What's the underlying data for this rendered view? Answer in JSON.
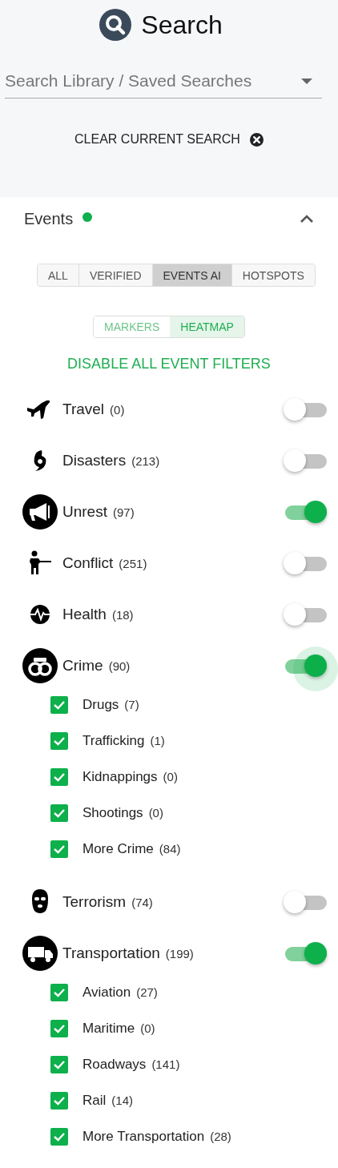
{
  "header": {
    "title": "Search"
  },
  "search": {
    "placeholder": "Search Library / Saved Searches"
  },
  "clear_button": {
    "label": "CLEAR CURRENT SEARCH"
  },
  "events": {
    "title": "Events",
    "active": true,
    "expanded": true,
    "source_tabs": [
      {
        "label": "ALL",
        "selected": false
      },
      {
        "label": "VERIFIED",
        "selected": false
      },
      {
        "label": "EVENTS AI",
        "selected": true
      },
      {
        "label": "HOTSPOTS",
        "selected": false
      }
    ],
    "view_tabs": [
      {
        "label": "MARKERS",
        "selected": false
      },
      {
        "label": "HEATMAP",
        "selected": true
      }
    ],
    "disable_all": "DISABLE ALL EVENT FILTERS",
    "categories": [
      {
        "label": "Travel",
        "count": "(0)",
        "on": false,
        "focused": false
      },
      {
        "label": "Disasters",
        "count": "(213)",
        "on": false,
        "focused": false
      },
      {
        "label": "Unrest",
        "count": "(97)",
        "on": true,
        "focused": false
      },
      {
        "label": "Conflict",
        "count": "(251)",
        "on": false,
        "focused": false
      },
      {
        "label": "Health",
        "count": "(18)",
        "on": false,
        "focused": false
      },
      {
        "label": "Crime",
        "count": "(90)",
        "on": true,
        "focused": true,
        "children": [
          {
            "label": "Drugs",
            "count": "(7)",
            "checked": true
          },
          {
            "label": "Trafficking",
            "count": "(1)",
            "checked": true
          },
          {
            "label": "Kidnappings",
            "count": "(0)",
            "checked": true
          },
          {
            "label": "Shootings",
            "count": "(0)",
            "checked": true
          },
          {
            "label": "More Crime",
            "count": "(84)",
            "checked": true
          }
        ]
      },
      {
        "label": "Terrorism",
        "count": "(74)",
        "on": false,
        "focused": false
      },
      {
        "label": "Transportation",
        "count": "(199)",
        "on": true,
        "focused": false,
        "children": [
          {
            "label": "Aviation",
            "count": "(27)",
            "checked": true
          },
          {
            "label": "Maritime",
            "count": "(0)",
            "checked": true
          },
          {
            "label": "Roadways",
            "count": "(141)",
            "checked": true
          },
          {
            "label": "Rail",
            "count": "(14)",
            "checked": true
          },
          {
            "label": "More Transportation",
            "count": "(28)",
            "checked": true
          }
        ]
      }
    ]
  }
}
